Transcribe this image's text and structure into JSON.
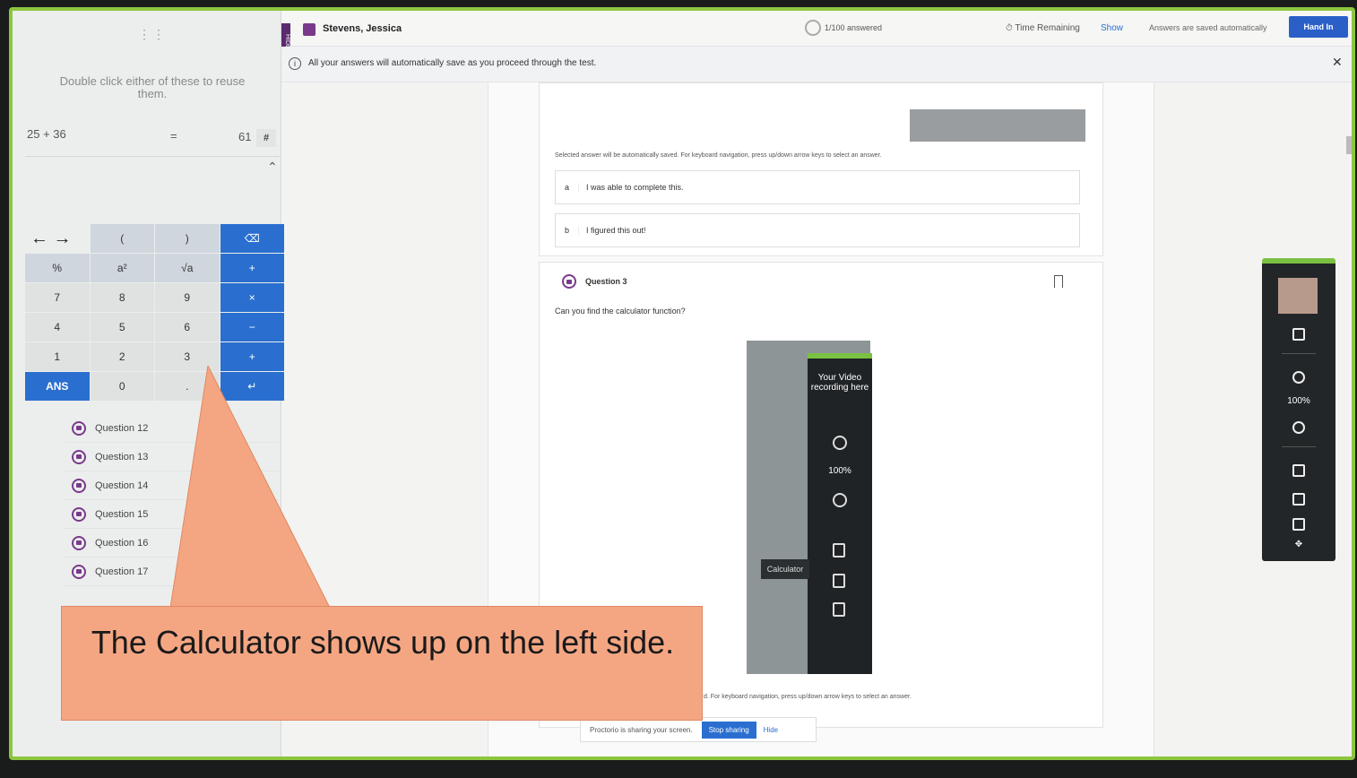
{
  "sidebar_calc": {
    "hint": "Double click either of these to reuse them.",
    "expression": "25 + 36",
    "equals": "=",
    "result": "61",
    "hash": "#",
    "rows": [
      [
        "←  →",
        "(",
        ")",
        "⌫"
      ],
      [
        "%",
        "a²",
        "√a",
        "+"
      ],
      [
        "7",
        "8",
        "9",
        "×"
      ],
      [
        "4",
        "5",
        "6",
        "−"
      ],
      [
        "1",
        "2",
        "3",
        "+"
      ],
      [
        "ANS",
        "0",
        ".",
        "↵"
      ]
    ]
  },
  "question_list": [
    "Question 12",
    "Question 13",
    "Question 14",
    "Question 15",
    "Question 16",
    "Question 17"
  ],
  "topbar": {
    "hide_tab": "HIDE",
    "student_name": "Stevens, Jessica",
    "progress": "1/100 answered",
    "time_label": "Time Remaining",
    "show": "Show",
    "saved": "Answers are saved automatically",
    "hand_in": "Hand In"
  },
  "infobar": {
    "message": "All your answers will automatically save as you proceed through the test."
  },
  "content": {
    "note": "Selected answer will be automatically saved. For keyboard navigation, press up/down arrow keys to select an answer.",
    "options": [
      {
        "letter": "a",
        "text": "I was able to complete this."
      },
      {
        "letter": "b",
        "text": "I figured this out!"
      }
    ],
    "question_title": "Question 3",
    "question_text": "Can you find the calculator function?",
    "video_text": "Your Video recording here",
    "zoom": "100%",
    "calc_tooltip": "Calculator",
    "note2": "d. For keyboard navigation, press up/down arrow keys to select an answer.",
    "share_text": "Proctorio is sharing your screen.",
    "stop_sharing": "Stop sharing",
    "hide": "Hide"
  },
  "right_toolbar": {
    "zoom": "100%"
  },
  "callout": {
    "text": "The Calculator shows up on the left side."
  },
  "colors": {
    "accent_green": "#8cc63f",
    "blue": "#2a6fd0",
    "callout": "#f4a683"
  }
}
